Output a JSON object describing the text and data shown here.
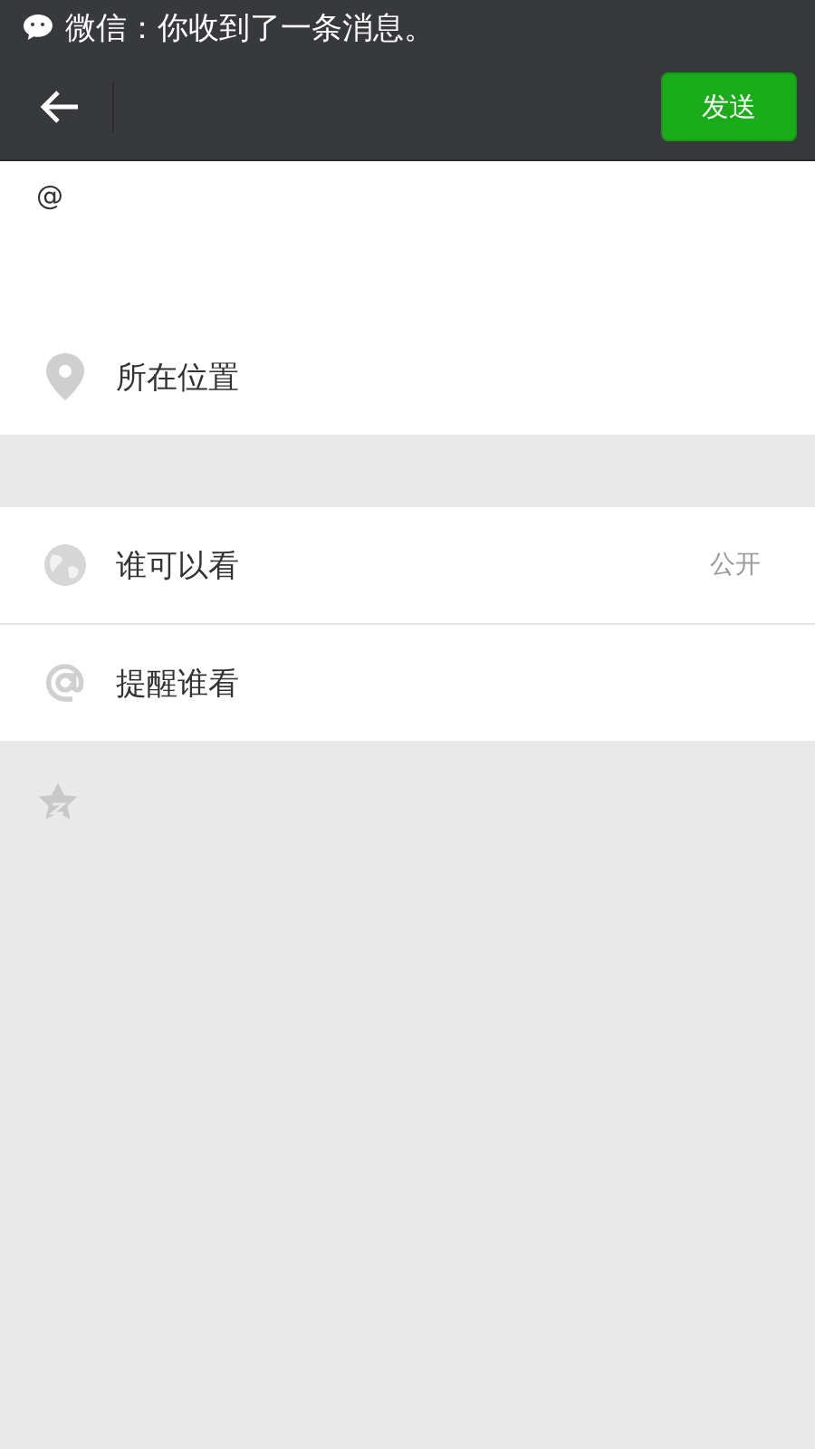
{
  "status_bar": {
    "notification": "微信：你收到了一条消息。"
  },
  "header": {
    "send_button": "发送"
  },
  "compose": {
    "value": "@"
  },
  "location": {
    "kind": "location",
    "label": "所在位置"
  },
  "settings": [
    {
      "kind": "visibility",
      "label": "谁可以看",
      "value": "公开"
    },
    {
      "kind": "mention",
      "label": "提醒谁看"
    }
  ]
}
